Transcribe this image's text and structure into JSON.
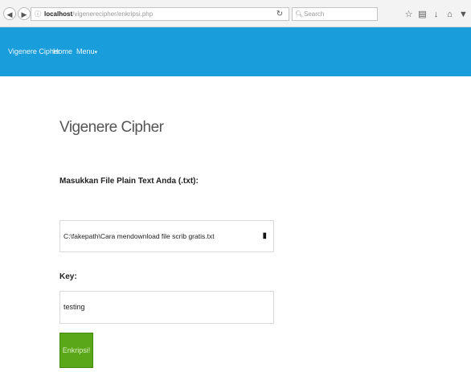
{
  "browser": {
    "back_icon": "back-arrow-icon",
    "forward_icon": "forward-arrow-icon",
    "url_host": "localhost",
    "url_path": "/vigenerecipher/enkripsi.php",
    "search_placeholder": "Search"
  },
  "navbar": {
    "brand": "Vigenere Cipher",
    "home": "Home",
    "menu": "Menu",
    "accent_color": "#1a9ddb"
  },
  "main": {
    "title": "Vigenere Cipher",
    "file_label": "Masukkan File Plain Text Anda (.txt):",
    "file_value": "C:\\fakepath\\Cara mendownload file scrib gratis.txt",
    "key_label": "Key:",
    "key_value": "testing",
    "submit_label": "Enkripsi!",
    "button_color": "#5aa818"
  }
}
